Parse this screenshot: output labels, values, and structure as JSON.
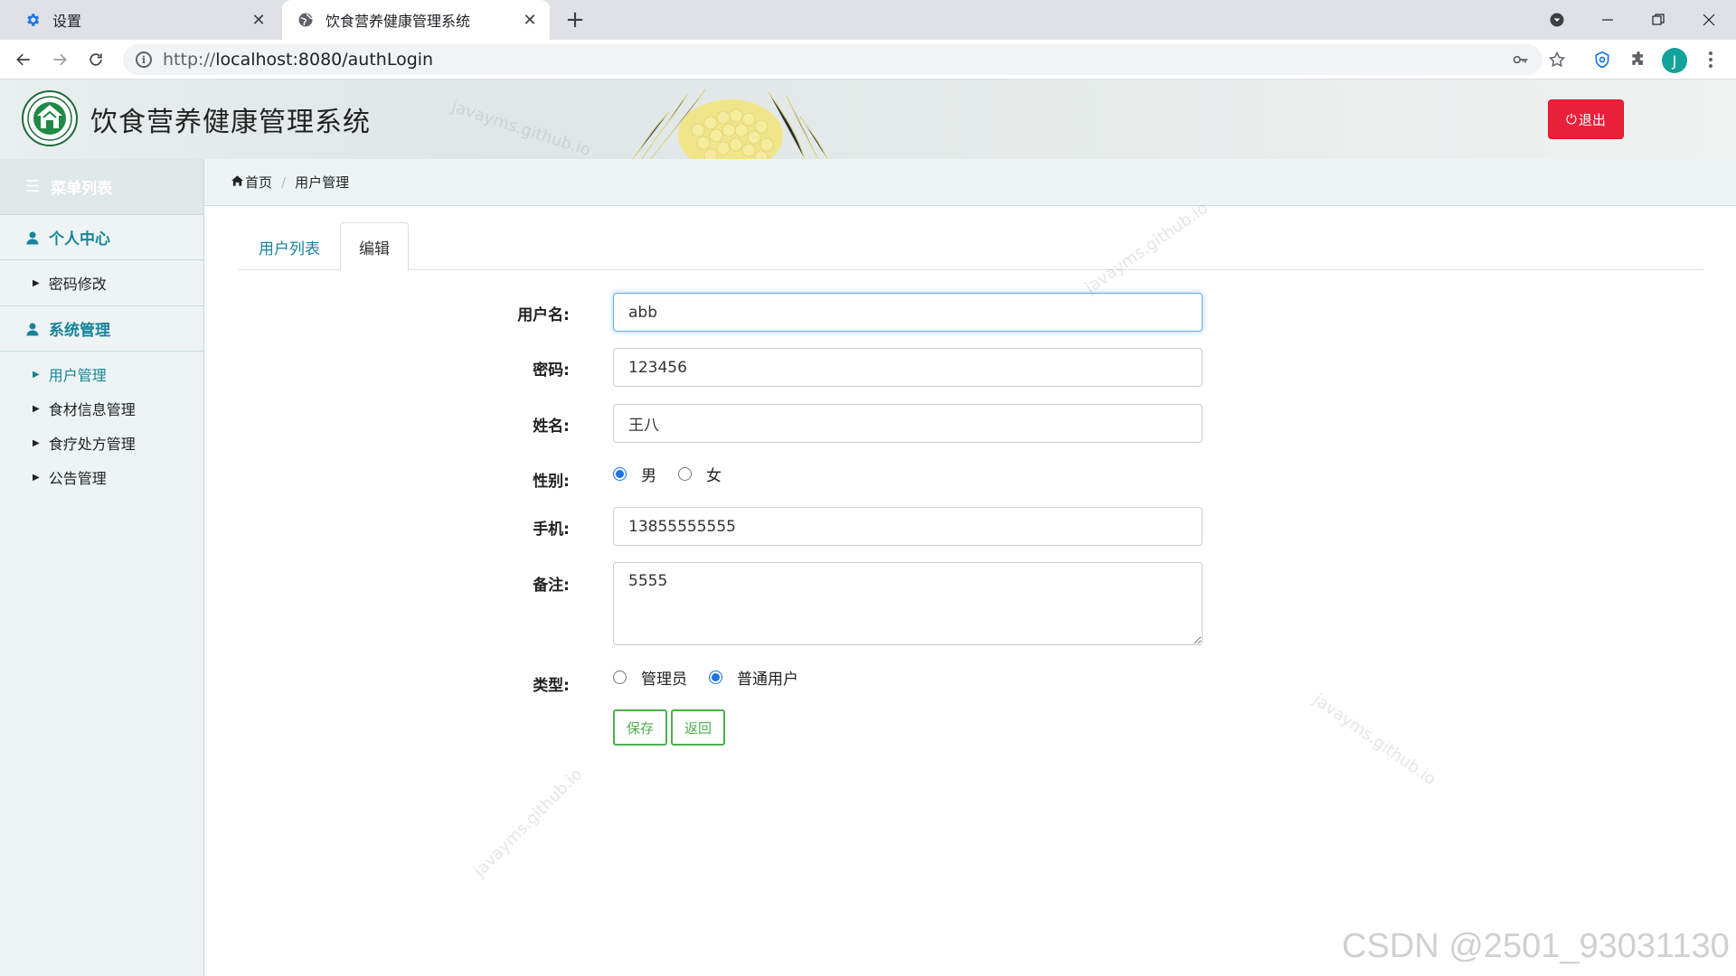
{
  "browser": {
    "tabs": [
      {
        "title": "设置",
        "icon": "gear-icon",
        "active": false
      },
      {
        "title": "饮食营养健康管理系统",
        "icon": "globe-icon",
        "active": true
      }
    ],
    "url_scheme": "http://",
    "url_host": "localhost:8080/authLogin",
    "avatar_letter": "J"
  },
  "header": {
    "title": "饮食营养健康管理系统",
    "logout_label": "退出"
  },
  "sidebar": {
    "heading": "菜单列表",
    "groups": [
      {
        "label": "个人中心",
        "items": [
          {
            "label": "密码修改",
            "active": false
          }
        ]
      },
      {
        "label": "系统管理",
        "items": [
          {
            "label": "用户管理",
            "active": true
          },
          {
            "label": "食材信息管理",
            "active": false
          },
          {
            "label": "食疗处方管理",
            "active": false
          },
          {
            "label": "公告管理",
            "active": false
          }
        ]
      }
    ]
  },
  "breadcrumb": {
    "home": "首页",
    "current": "用户管理"
  },
  "tabs": {
    "list": "用户列表",
    "edit": "编辑"
  },
  "form": {
    "username_label": "用户名:",
    "username_value": "abb",
    "password_label": "密码:",
    "password_value": "123456",
    "name_label": "姓名:",
    "name_value": "王八",
    "gender_label": "性别:",
    "gender_options": [
      "男",
      "女"
    ],
    "gender_selected": "男",
    "phone_label": "手机:",
    "phone_value": "13855555555",
    "remark_label": "备注:",
    "remark_value": "5555",
    "type_label": "类型:",
    "type_options": [
      "管理员",
      "普通用户"
    ],
    "type_selected": "普通用户",
    "save_label": "保存",
    "back_label": "返回"
  },
  "watermarks": {
    "site": "javayms.github.io",
    "csdn": "CSDN @2501_93031130"
  },
  "colors": {
    "accent": "#17849a",
    "danger": "#e8203a",
    "success": "#4cae4c",
    "focus": "#66afe9"
  }
}
